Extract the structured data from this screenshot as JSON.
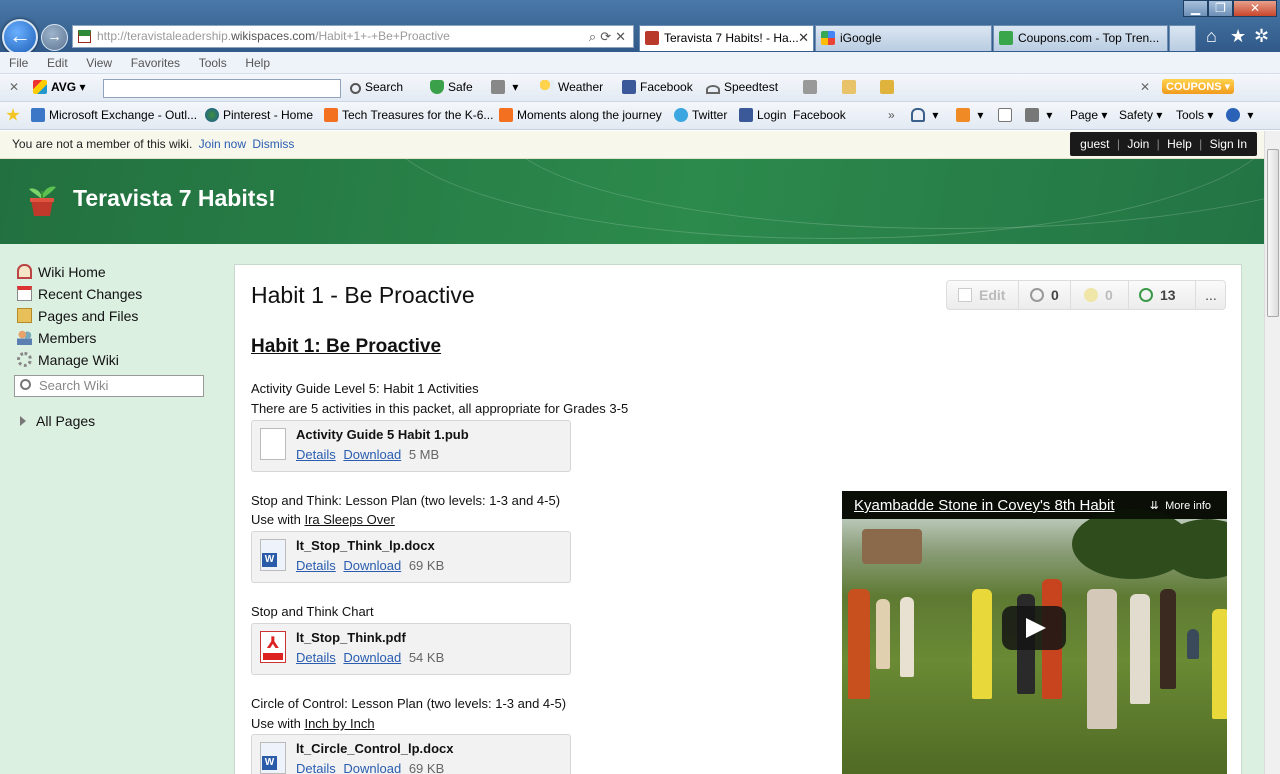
{
  "browser": {
    "address": {
      "prefix": "http://teravistaleadership.",
      "host": "wikispaces.com",
      "path": "/Habit+1+-+Be+Proactive",
      "buttons": "⌕⟳✕"
    },
    "tabs": [
      {
        "label": "Teravista 7 Habits! - Ha...",
        "active": true,
        "close": "✕"
      },
      {
        "label": "iGoogle",
        "active": false
      },
      {
        "label": "Coupons.com - Top Tren...",
        "active": false
      }
    ],
    "window_buttons": [
      "▁",
      "❐",
      "✕"
    ],
    "menu": [
      "File",
      "Edit",
      "View",
      "Favorites",
      "Tools",
      "Help"
    ],
    "avg_toolbar": {
      "close": "✕",
      "brand": "AVG",
      "search_label": "Search",
      "safe_label": "Safe",
      "weather_label": "Weather",
      "facebook_label": "Facebook",
      "speedtest_label": "Speedtest",
      "coupons_label": "COUPONS",
      "close2": "✕"
    },
    "favorites": [
      "Microsoft Exchange - Outl...",
      "Pinterest - Home",
      "Tech Treasures for the K-6...",
      "Moments along the journey",
      "Twitter",
      "Login",
      "Facebook"
    ],
    "command_bar": [
      "Page ▾",
      "Safety ▾",
      "Tools ▾"
    ]
  },
  "wiki": {
    "notice": {
      "text": "You are not a member of this wiki.",
      "join": "Join now",
      "dismiss": "Dismiss"
    },
    "userbar": {
      "guest": "guest",
      "join": "Join",
      "help": "Help",
      "signin": "Sign In",
      "sep": "|"
    },
    "site_title": "Teravista 7 Habits!",
    "sidebar": {
      "items": [
        {
          "label": "Wiki Home",
          "icon": "home-icon"
        },
        {
          "label": "Recent Changes",
          "icon": "calendar-icon"
        },
        {
          "label": "Pages and Files",
          "icon": "folder-icon"
        },
        {
          "label": "Members",
          "icon": "members-icon"
        },
        {
          "label": "Manage Wiki",
          "icon": "gear-icon"
        }
      ],
      "search_placeholder": "Search Wiki",
      "all_pages": "All Pages"
    },
    "page": {
      "title": "Habit 1 - Be Proactive",
      "actions": {
        "edit": "Edit",
        "links": "0",
        "comments": "0",
        "history": "13",
        "more": "..."
      },
      "heading": "Habit 1: Be Proactive",
      "sections": [
        {
          "line1": "Activity Guide Level 5: Habit 1 Activities",
          "line2": "There are 5 activities in this packet, all appropriate for Grades 3-5",
          "file": {
            "name": "Activity Guide 5 Habit 1.pub",
            "details": "Details",
            "download": "Download",
            "size": "5 MB",
            "type": "generic"
          }
        },
        {
          "line1": "Stop and Think: Lesson Plan (two levels: 1-3 and 4-5)",
          "line2_prefix": "Use with ",
          "line2_link": "Ira Sleeps Over",
          "file": {
            "name": "lt_Stop_Think_lp.docx",
            "details": "Details",
            "download": "Download",
            "size": "69 KB",
            "type": "word"
          }
        },
        {
          "line1": "Stop and Think Chart",
          "file": {
            "name": "lt_Stop_Think.pdf",
            "details": "Details",
            "download": "Download",
            "size": "54 KB",
            "type": "pdf"
          }
        },
        {
          "line1": "Circle of Control: Lesson Plan (two levels: 1-3 and 4-5)",
          "line2_prefix": "Use with ",
          "line2_link": "Inch by Inch",
          "file": {
            "name": "lt_Circle_Control_lp.docx",
            "details": "Details",
            "download": "Download",
            "size": "69 KB",
            "type": "word"
          }
        }
      ],
      "video": {
        "title": "Kyambadde Stone in Covey's 8th Habit",
        "more_info": "More info"
      }
    }
  },
  "colors": {
    "header_green": "#2c8a4c",
    "page_bg": "#dcf0e2",
    "link_blue": "#2a5db0"
  }
}
